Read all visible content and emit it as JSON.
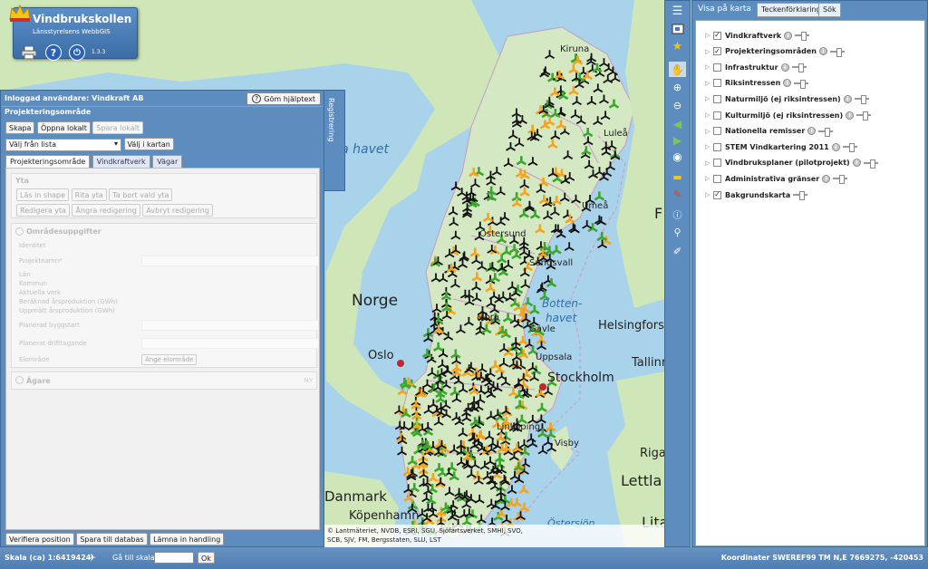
{
  "app": {
    "title": "Vindbrukskollen",
    "subtitle": "Länsstyrelsens WebbGIS",
    "version": "1.3.3"
  },
  "map_labels": {
    "norge": "Norge",
    "oslo": "Oslo",
    "stockholm": "Stockholm",
    "kiruna": "Kiruna",
    "lulea": "Luleå",
    "umea": "Umeå",
    "ostersund": "Östersund",
    "sundsvall": "Sundsvall",
    "gavle": "Gävle",
    "mora": "Mora",
    "uppsala": "Uppsala",
    "linkoping": "Linköping",
    "visby": "Visby",
    "danmark": "Danmark",
    "kopenhamn": "Köpenhamn",
    "helsingfors": "Helsingfors",
    "tallinn": "Tallinn",
    "riga": "Riga",
    "lettland": "Lettla",
    "lita": "Lita",
    "f": "F",
    "bottenhavet1": "Botten-",
    "bottenhavet2": "havet",
    "norska_havet": "ka havet",
    "ostersjon": "Östersjön"
  },
  "attribution": [
    "© Lantmäteriet, NVDB, ESRI, SGU, Sjöfartsverket, SMHI, SVO,",
    "SCB, SJV, FM, Bergsstaten, SLU, LST"
  ],
  "left_panel": {
    "user_label": "Inloggad användare: Vindkraft AB",
    "help_button": "Göm hjälptext",
    "section_title": "Projekteringsområde",
    "btn_create": "Skapa",
    "btn_open_local": "Öppna lokalt",
    "btn_save_local": "Spara lokalt",
    "select_value": "Välj från lista",
    "btn_pick_map": "Välj i kartan",
    "tabs": [
      "Projekteringsområde",
      "Vindkraftverk",
      "Vägar"
    ],
    "yta_title": "Yta",
    "yta_buttons": [
      "Läs in shape",
      "Rita yta",
      "Ta bort vald yta"
    ],
    "yta_buttons2": [
      "Redigera yta",
      "Ångra redigering",
      "Avbryt redigering"
    ],
    "area_info_title": "Områdesuppgifter",
    "fields": [
      "Identitet",
      "Projektnamn*",
      "Län",
      "Kommun",
      "Aktuella verk",
      "Beräknad årsproduktion (GWh)",
      "Uppmätt årsproduktion (GWh)",
      "Planerad byggstart",
      "Planerat drifttagande",
      "Elområde"
    ],
    "elomrade_placeholder": "Ange elområde",
    "owner_title": "Ägare",
    "owner_tag": "NY",
    "bottom_buttons": [
      "Verifiera position",
      "Spara till databas",
      "Lämna in handling"
    ]
  },
  "registrering_tab": "Registrering",
  "right_panel": {
    "tabs": [
      "Visa på karta",
      "Teckenförklaring",
      "Sök"
    ],
    "layers": [
      {
        "label": "Vindkraftverk",
        "checked": true
      },
      {
        "label": "Projekteringsområden",
        "checked": true
      },
      {
        "label": "Infrastruktur",
        "checked": false
      },
      {
        "label": "Riksintressen",
        "checked": false
      },
      {
        "label": "Naturmiljö (ej riksintressen)",
        "checked": false
      },
      {
        "label": "Kulturmiljö (ej riksintressen)",
        "checked": false
      },
      {
        "label": "Nationella remisser",
        "checked": false
      },
      {
        "label": "STEM Vindkartering 2011",
        "checked": false
      },
      {
        "label": "Vindbruksplaner (pilotprojekt)",
        "checked": false
      },
      {
        "label": "Administrativa gränser",
        "checked": false
      },
      {
        "label": "Bakgrundskarta",
        "checked": true
      }
    ]
  },
  "status": {
    "scale_label": "Skala (ca) 1:6419424",
    "goto_label": "Gå till skala",
    "ok_button": "Ok",
    "coords": "Koordinater SWEREF99 TM N,E 7669275, -420453"
  },
  "colors": {
    "panel": "#5d8dbf",
    "sea": "#a9d3ea",
    "land": "#cfe6b8",
    "turbine": "#111111",
    "orange": "#f4a31b",
    "green": "#3aa82c"
  }
}
